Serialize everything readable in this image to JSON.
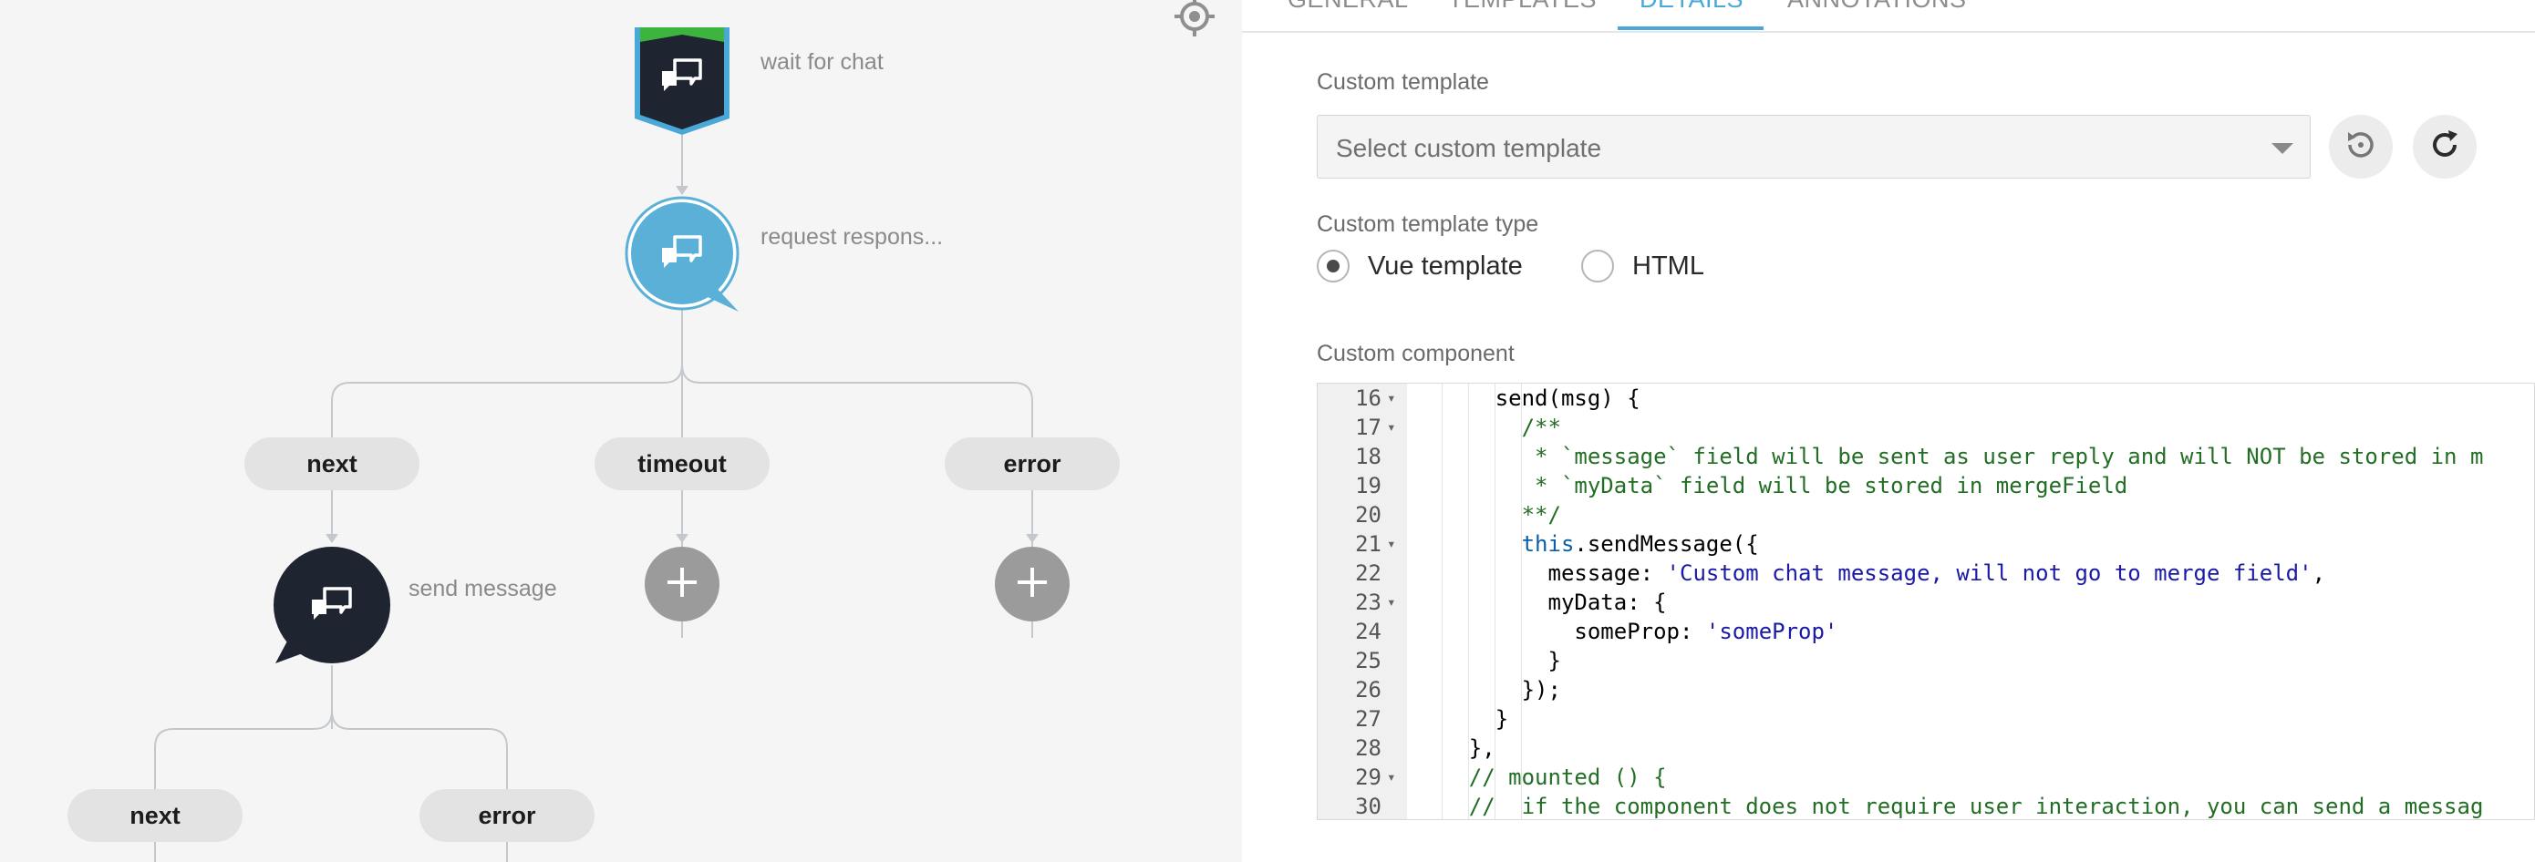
{
  "flow": {
    "nodes": [
      {
        "label": "wait for chat",
        "icon": "chat-bubbles-icon",
        "color": "#1e2430",
        "accent": "#4aa8d8",
        "top_color": "#3db43d"
      },
      {
        "label": "request respons...",
        "icon": "chat-bubbles-icon",
        "color": "#5bb0d8"
      },
      {
        "label": "send message",
        "icon": "chat-bubbles-icon",
        "color": "#1e2430"
      }
    ],
    "branches_request": [
      "next",
      "timeout",
      "error"
    ],
    "branches_send": [
      "next",
      "error"
    ],
    "add_icon": "plus-icon",
    "recenter_icon": "crosshair-icon"
  },
  "panel": {
    "tabs": [
      "GENERAL",
      "TEMPLATES",
      "DETAILS",
      "ANNOTATIONS"
    ],
    "active_tab": "DETAILS",
    "accent": "#4aa8d8",
    "custom_template": {
      "label": "Custom template",
      "placeholder": "Select custom template",
      "reset_icon": "history-reset-icon",
      "refresh_icon": "refresh-icon"
    },
    "template_type": {
      "label": "Custom template type",
      "options": [
        "Vue template",
        "HTML"
      ],
      "selected": "Vue template"
    },
    "custom_component": {
      "label": "Custom component",
      "lines": [
        {
          "n": "16",
          "fold": true,
          "segments": [
            {
              "t": "      send(msg) {",
              "k": "plain"
            }
          ]
        },
        {
          "n": "17",
          "fold": true,
          "segments": [
            {
              "t": "        /**",
              "k": "com"
            }
          ]
        },
        {
          "n": "18",
          "fold": false,
          "segments": [
            {
              "t": "         * `message` field will be sent as user reply and will NOT be stored in m",
              "k": "com"
            }
          ]
        },
        {
          "n": "19",
          "fold": false,
          "segments": [
            {
              "t": "         * `myData` field will be stored in mergeField",
              "k": "com"
            }
          ]
        },
        {
          "n": "20",
          "fold": false,
          "segments": [
            {
              "t": "        **/",
              "k": "com"
            }
          ]
        },
        {
          "n": "21",
          "fold": true,
          "segments": [
            {
              "t": "        ",
              "k": "plain"
            },
            {
              "t": "this",
              "k": "kw"
            },
            {
              "t": ".sendMessage({",
              "k": "plain"
            }
          ]
        },
        {
          "n": "22",
          "fold": false,
          "segments": [
            {
              "t": "          message: ",
              "k": "plain"
            },
            {
              "t": "'Custom chat message, will not go to merge field'",
              "k": "str"
            },
            {
              "t": ",",
              "k": "plain"
            }
          ]
        },
        {
          "n": "23",
          "fold": true,
          "segments": [
            {
              "t": "          myData: {",
              "k": "plain"
            }
          ]
        },
        {
          "n": "24",
          "fold": false,
          "segments": [
            {
              "t": "            someProp: ",
              "k": "plain"
            },
            {
              "t": "'someProp'",
              "k": "str"
            }
          ]
        },
        {
          "n": "25",
          "fold": false,
          "segments": [
            {
              "t": "          }",
              "k": "plain"
            }
          ]
        },
        {
          "n": "26",
          "fold": false,
          "segments": [
            {
              "t": "        });",
              "k": "plain"
            }
          ]
        },
        {
          "n": "27",
          "fold": false,
          "segments": [
            {
              "t": "      }",
              "k": "plain"
            }
          ]
        },
        {
          "n": "28",
          "fold": false,
          "segments": [
            {
              "t": "    },",
              "k": "plain"
            }
          ]
        },
        {
          "n": "29",
          "fold": true,
          "segments": [
            {
              "t": "    // mounted () {",
              "k": "com"
            }
          ]
        },
        {
          "n": "30",
          "fold": false,
          "segments": [
            {
              "t": "    //  if the component does not require user interaction, you can send a messag",
              "k": "com"
            }
          ]
        }
      ]
    }
  }
}
